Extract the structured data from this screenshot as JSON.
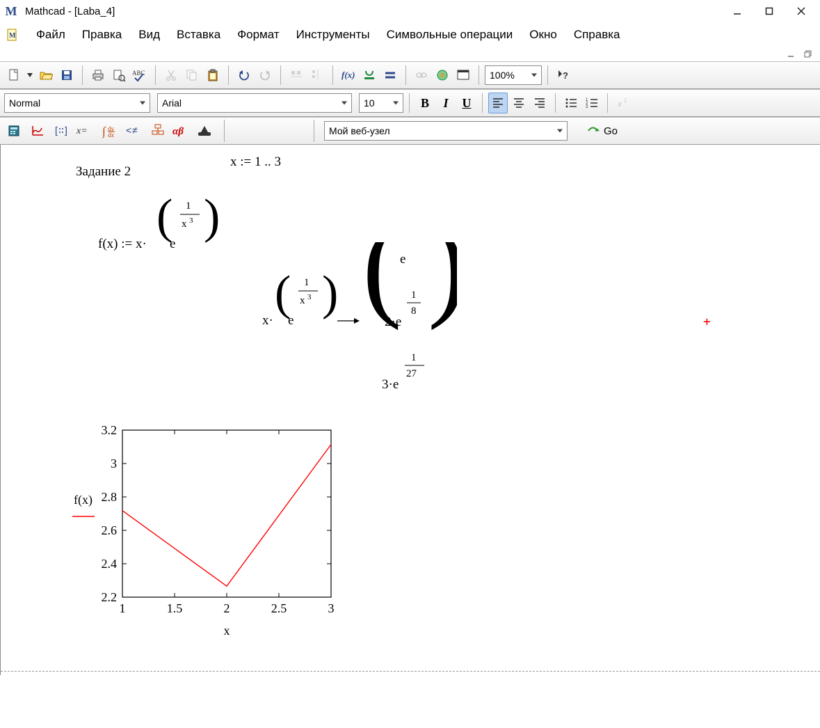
{
  "title": "Mathcad - [Laba_4]",
  "menu": {
    "items": [
      "Файл",
      "Правка",
      "Вид",
      "Вставка",
      "Формат",
      "Инструменты",
      "Символьные операции",
      "Окно",
      "Справка"
    ]
  },
  "toolbar1": {
    "zoom": "100%"
  },
  "toolbar2": {
    "style": "Normal",
    "font": "Arial",
    "font_size": "10"
  },
  "toolbar3": {
    "web_selected": "Мой веб-узел",
    "go_label": "Go"
  },
  "worksheet": {
    "task_label": "Задание 2",
    "x_range": "x := 1 .. 3",
    "fx_lhs": "f(x)",
    "cursor_marker": "+"
  },
  "chart_data": {
    "type": "line",
    "x": [
      1,
      2,
      3
    ],
    "y": [
      2.718,
      2.266,
      3.114
    ],
    "x_ticks": [
      1,
      1.5,
      2,
      2.5,
      3
    ],
    "y_ticks": [
      2.2,
      2.4,
      2.6,
      2.8,
      3,
      3.2
    ],
    "xlabel": "x",
    "ylabel": "f(x)",
    "xlim": [
      1,
      3
    ],
    "ylim": [
      2.2,
      3.2
    ],
    "color": "#ff0000"
  }
}
